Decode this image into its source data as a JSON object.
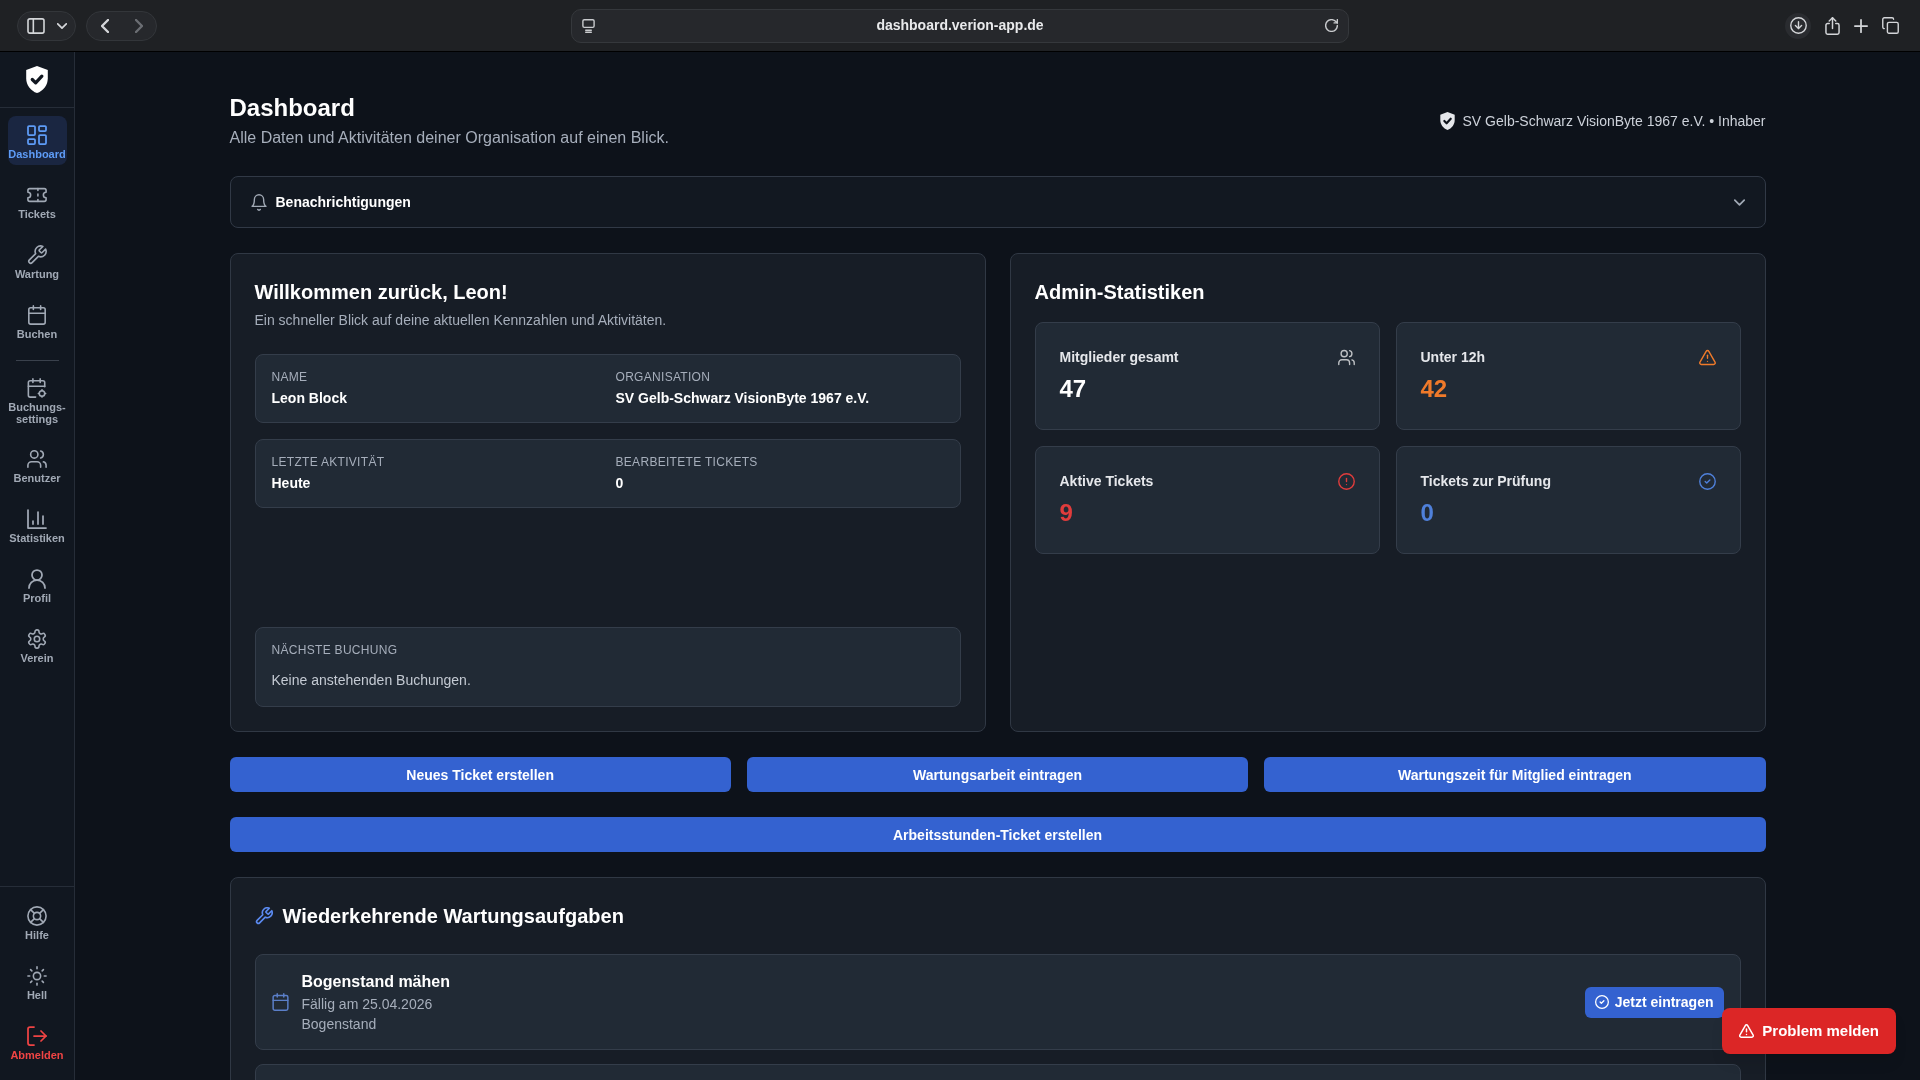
{
  "browser": {
    "url": "dashboard.verion-app.de"
  },
  "sidebar": {
    "sections": [
      {
        "items": [
          {
            "label": "Dashboard",
            "selected": true
          },
          {
            "label": "Tickets",
            "selected": false
          },
          {
            "label": "Wartung",
            "selected": false
          },
          {
            "label": "Buchen",
            "selected": false
          }
        ]
      },
      {
        "items": [
          {
            "label": "Buchungs-settings",
            "selected": false
          },
          {
            "label": "Benutzer",
            "selected": false
          },
          {
            "label": "Statistiken",
            "selected": false
          },
          {
            "label": "Profil",
            "selected": false
          },
          {
            "label": "Verein",
            "selected": false
          }
        ]
      }
    ],
    "bottom_items": [
      {
        "label": "Hilfe",
        "kind": "normal"
      },
      {
        "label": "Hell",
        "kind": "normal"
      },
      {
        "label": "Abmelden",
        "kind": "danger"
      }
    ]
  },
  "page_header": {
    "title": "Dashboard",
    "subtitle": "Alle Daten und Aktivitäten deiner Organisation auf einen Blick.",
    "organization": "SV Gelb-Schwarz VisionByte 1967 e.V. • Inhaber"
  },
  "notifications": {
    "title": "Benachrichtigungen",
    "expanded": false
  },
  "welcome": {
    "title": "Willkommen zurück, Leon!",
    "subtitle": "Ein schneller Blick auf deine aktuellen Kennzahlen und Aktivitäten.",
    "info_rows": [
      [
        {
          "label": "NAME",
          "value": "Leon Block"
        },
        {
          "label": "ORGANISATION",
          "value": "SV Gelb-Schwarz VisionByte 1967 e.V."
        }
      ],
      [
        {
          "label": "LETZTE AKTIVITÄT",
          "value": "Heute"
        },
        {
          "label": "BEARBEITETE TICKETS",
          "value": "0"
        }
      ]
    ],
    "next_booking": {
      "label": "NÄCHSTE BUCHUNG",
      "text": "Keine anstehenden Buchungen."
    }
  },
  "admin_stats": {
    "title": "Admin-Statistiken",
    "stats": [
      {
        "label": "Mitglieder gesamt",
        "value": "47",
        "color": "#ffffff"
      },
      {
        "label": "Unter 12h",
        "value": "42",
        "color": "#f07a2a"
      },
      {
        "label": "Aktive Tickets",
        "value": "9",
        "color": "#e03c3c"
      },
      {
        "label": "Tickets zur Prüfung",
        "value": "0",
        "color": "#4f80da"
      }
    ]
  },
  "action_rows": [
    [
      {
        "label": "Neues Ticket erstellen"
      },
      {
        "label": "Wartungsarbeit eintragen"
      },
      {
        "label": "Wartungszeit für Mitglied eintragen"
      }
    ],
    [
      {
        "label": "Arbeitsstunden-Ticket erstellen"
      }
    ]
  ],
  "maintenance": {
    "title": "Wiederkehrende Wartungsaufgaben",
    "tasks": [
      {
        "title": "Bogenstand mähen",
        "due": "Fällig am 25.04.2026",
        "location": "Bogenstand",
        "action": "Jetzt eintragen"
      }
    ],
    "more_below": true
  },
  "report_button": {
    "label": "Problem melden"
  }
}
